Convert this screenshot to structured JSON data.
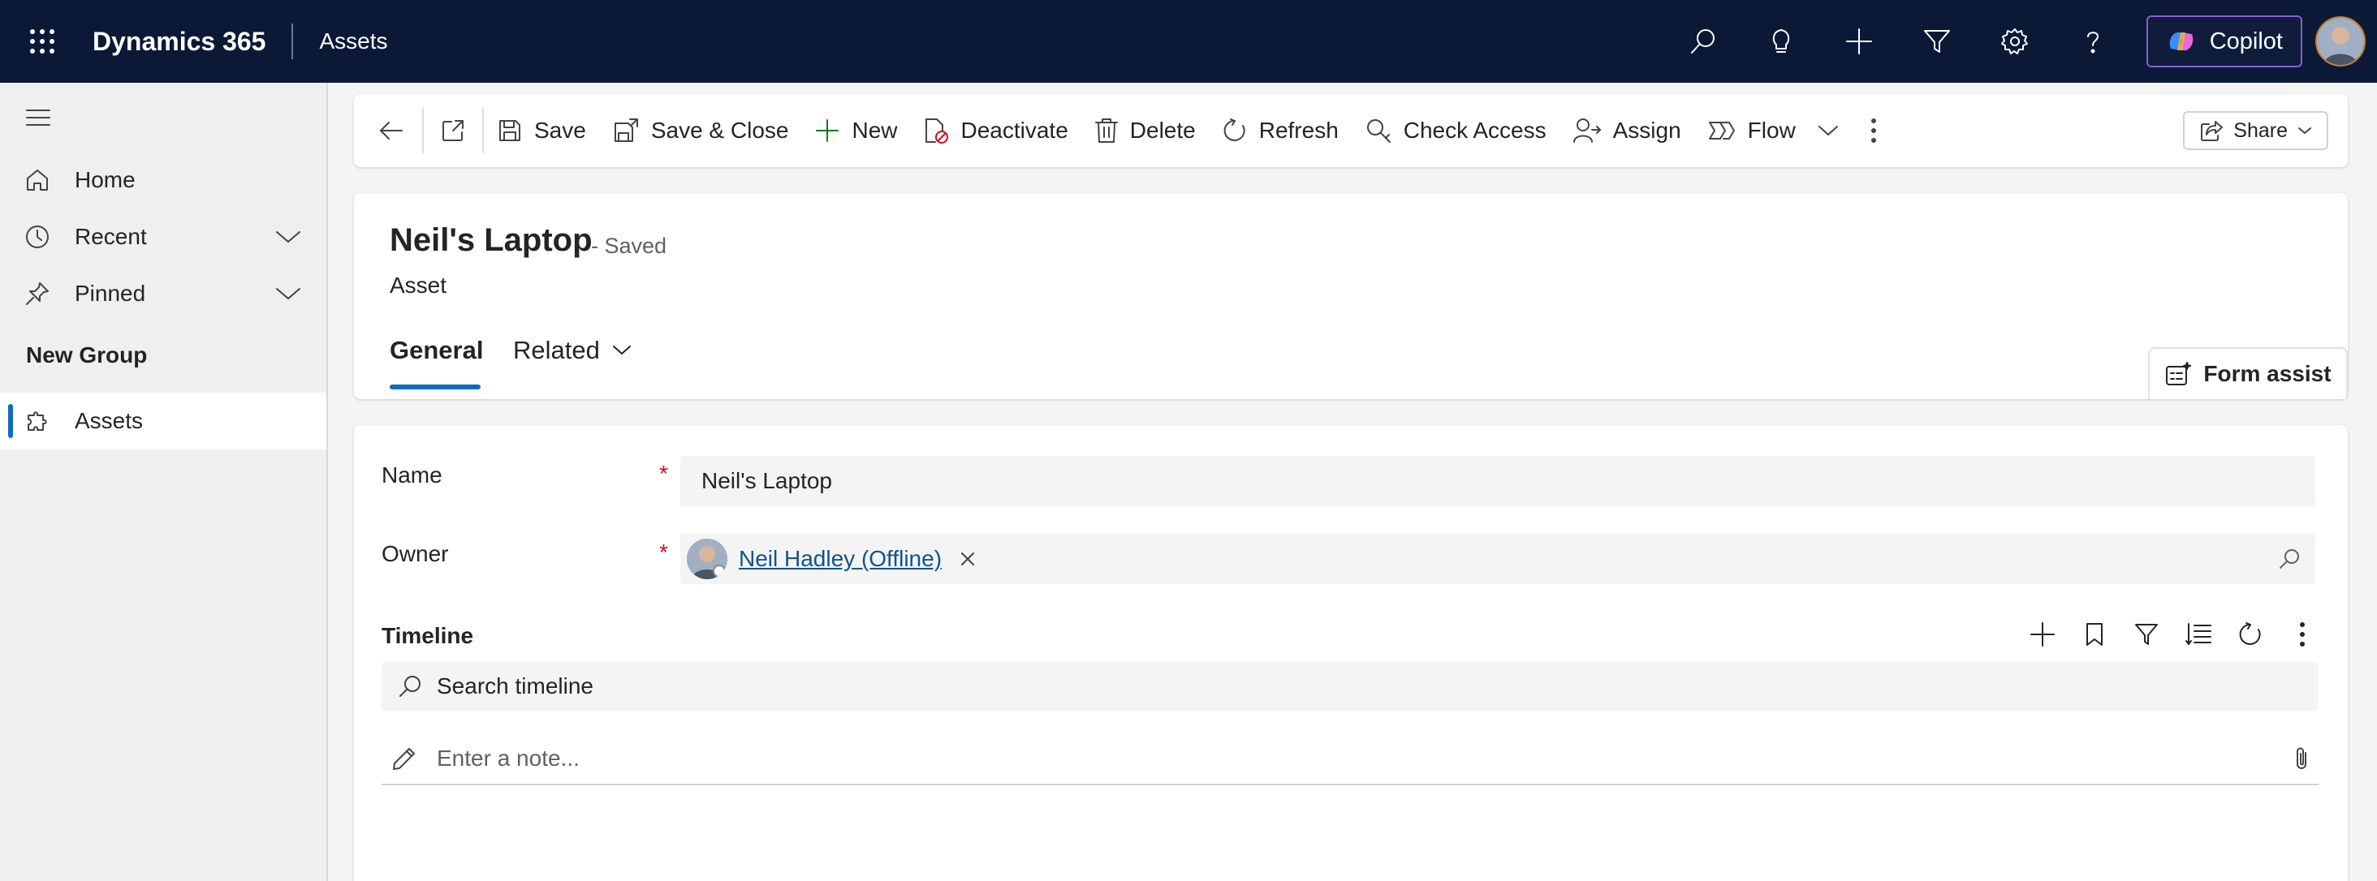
{
  "topbar": {
    "app_title": "Dynamics 365",
    "area_title": "Assets",
    "copilot_label": "Copilot",
    "icons": [
      "waffle-icon",
      "search-icon",
      "lightbulb-icon",
      "plus-icon",
      "filter-icon",
      "gear-icon",
      "help-icon"
    ]
  },
  "nav": {
    "items": [
      {
        "label": "Home",
        "icon": "home-icon"
      },
      {
        "label": "Recent",
        "icon": "clock-icon"
      },
      {
        "label": "Pinned",
        "icon": "pin-icon"
      }
    ],
    "group_title": "New Group",
    "group_items": [
      {
        "label": "Assets",
        "icon": "puzzle-icon",
        "active": true
      }
    ]
  },
  "commands": {
    "save": "Save",
    "save_close": "Save & Close",
    "new": "New",
    "deactivate": "Deactivate",
    "delete": "Delete",
    "refresh": "Refresh",
    "check_access": "Check Access",
    "assign": "Assign",
    "flow": "Flow",
    "share": "Share"
  },
  "record": {
    "title": "Neil's Laptop",
    "status": "- Saved",
    "entity": "Asset"
  },
  "tabs": [
    {
      "label": "General",
      "active": true
    },
    {
      "label": "Related",
      "active": false
    }
  ],
  "form_assist_label": "Form assist",
  "fields": {
    "name_label": "Name",
    "name_value": "Neil's Laptop",
    "owner_label": "Owner",
    "owner_value": "Neil Hadley (Offline)",
    "required_marker": "*"
  },
  "timeline": {
    "title": "Timeline",
    "search_label": "Search timeline",
    "note_placeholder": "Enter a note..."
  },
  "colors": {
    "topbar_bg": "#0b1937",
    "accent": "#0f6cbd",
    "required": "#c50f1f",
    "link": "#0f548c"
  }
}
